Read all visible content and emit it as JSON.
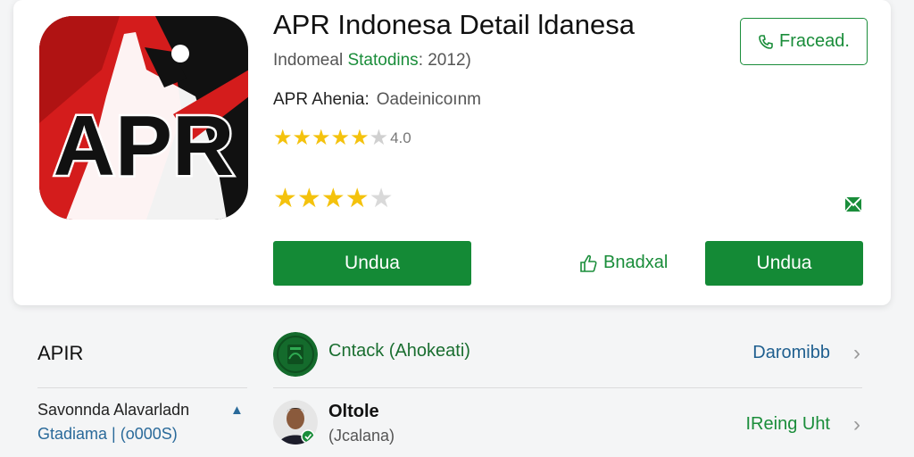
{
  "app": {
    "icon_text": "APR",
    "title": "APR Indonesa Detail ldanesa",
    "meta_prefix": "Indomeal",
    "meta_category": "Statodins",
    "meta_suffix": ": 2012)",
    "developer_label": "APR Ahenia:",
    "developer_value": "Oadeinicoınm",
    "rating_score": "4.0",
    "rating_stars": 4
  },
  "actions": {
    "share_label": "Fracead.",
    "primary_label": "Undua",
    "bookmark_label": "Bnadxal",
    "secondary_label": "Undua"
  },
  "sidebar": {
    "section_title": "APIR",
    "item_line1": "Savonnda Alavarladn",
    "item_line2": "Gtadiama | (o000S)"
  },
  "list": {
    "rows": [
      {
        "title": "Cntack (Ahokeati)",
        "subtitle": "",
        "right_label": "Daromibb"
      },
      {
        "title": "Oltole",
        "subtitle": "(Jcalana)",
        "right_label": "IReing Uht"
      }
    ]
  },
  "colors": {
    "accent_green": "#148a36",
    "star_yellow": "#f4c20d",
    "link_blue": "#1f5f8f"
  }
}
